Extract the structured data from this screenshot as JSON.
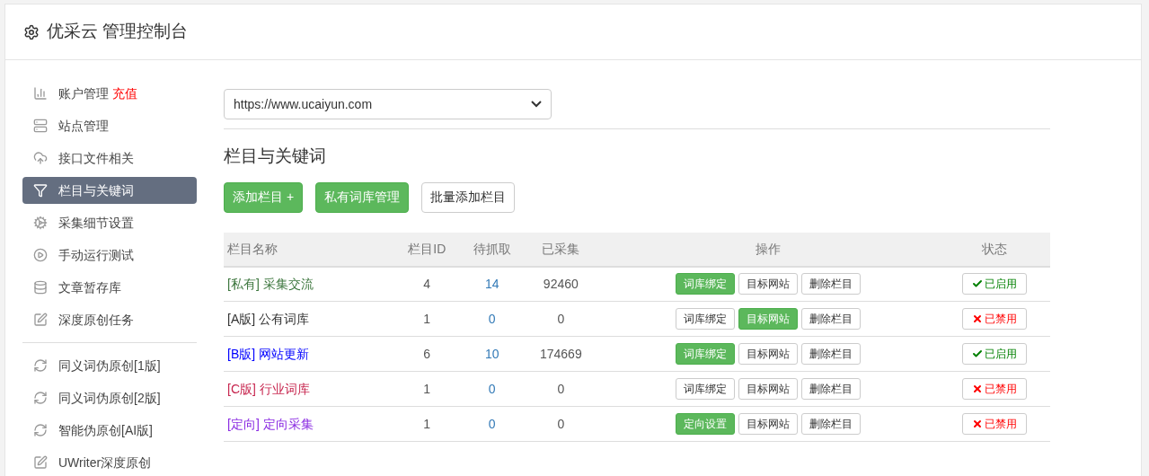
{
  "header": {
    "title": "优采云 管理控制台"
  },
  "sidebar": {
    "groups": [
      {
        "items": [
          {
            "kind": "chart",
            "label": "账户管理",
            "badge": "充值",
            "selected": false
          },
          {
            "kind": "server",
            "label": "站点管理",
            "selected": false
          },
          {
            "kind": "cloud",
            "label": "接口文件相关",
            "selected": false
          },
          {
            "kind": "filter",
            "label": "栏目与关键词",
            "selected": true
          },
          {
            "kind": "cogs",
            "label": "采集细节设置",
            "selected": false
          },
          {
            "kind": "play",
            "label": "手动运行测试",
            "selected": false
          },
          {
            "kind": "database",
            "label": "文章暂存库",
            "selected": false
          },
          {
            "kind": "edit",
            "label": "深度原创任务",
            "selected": false
          }
        ]
      },
      {
        "items": [
          {
            "kind": "refresh",
            "label": "同义词伪原创[1版]",
            "selected": false
          },
          {
            "kind": "refresh",
            "label": "同义词伪原创[2版]",
            "selected": false
          },
          {
            "kind": "refresh",
            "label": "智能伪原创[AI版]",
            "selected": false
          },
          {
            "kind": "edit",
            "label": "UWriter深度原创",
            "selected": false
          }
        ]
      }
    ]
  },
  "site_select": {
    "value": "https://www.ucaiyun.com"
  },
  "section_title": "栏目与关键词",
  "toolbar": [
    {
      "label": "添加栏目 +",
      "kind": "primary"
    },
    {
      "label": "私有词库管理",
      "kind": "primary"
    },
    {
      "label": "批量添加栏目",
      "kind": "default"
    }
  ],
  "table": {
    "columns": [
      "栏目名称",
      "栏目ID",
      "待抓取",
      "已采集",
      "操作",
      "状态"
    ],
    "rows": [
      {
        "tag": "[私有]",
        "name": "采集交流",
        "color": "#3c763d",
        "id": "4",
        "pending": "14",
        "collected": "92460",
        "actions": [
          {
            "label": "词库绑定",
            "highlighted": true
          },
          {
            "label": "目标网站",
            "highlighted": false
          },
          {
            "label": "删除栏目",
            "highlighted": false
          }
        ],
        "status": {
          "label": "已启用",
          "enabled": true
        }
      },
      {
        "tag": "[A版]",
        "name": "公有词库",
        "color": "#333333",
        "id": "1",
        "pending": "0",
        "collected": "0",
        "actions": [
          {
            "label": "词库绑定",
            "highlighted": false
          },
          {
            "label": "目标网站",
            "highlighted": true
          },
          {
            "label": "删除栏目",
            "highlighted": false
          }
        ],
        "status": {
          "label": "已禁用",
          "enabled": false
        }
      },
      {
        "tag": "[B版]",
        "name": "网站更新",
        "color": "#0000ff",
        "id": "6",
        "pending": "10",
        "collected": "174669",
        "actions": [
          {
            "label": "词库绑定",
            "highlighted": true
          },
          {
            "label": "目标网站",
            "highlighted": false
          },
          {
            "label": "删除栏目",
            "highlighted": false
          }
        ],
        "status": {
          "label": "已启用",
          "enabled": true
        }
      },
      {
        "tag": "[C版]",
        "name": "行业词库",
        "color": "#c7254e",
        "id": "1",
        "pending": "0",
        "collected": "0",
        "actions": [
          {
            "label": "词库绑定",
            "highlighted": false
          },
          {
            "label": "目标网站",
            "highlighted": false
          },
          {
            "label": "删除栏目",
            "highlighted": false
          }
        ],
        "status": {
          "label": "已禁用",
          "enabled": false
        }
      },
      {
        "tag": "[定向]",
        "name": "定向采集",
        "color": "#8a2be2",
        "id": "1",
        "pending": "0",
        "collected": "0",
        "actions": [
          {
            "label": "定向设置",
            "highlighted": true
          },
          {
            "label": "目标网站",
            "highlighted": false
          },
          {
            "label": "删除栏目",
            "highlighted": false
          }
        ],
        "status": {
          "label": "已禁用",
          "enabled": false
        }
      }
    ]
  }
}
